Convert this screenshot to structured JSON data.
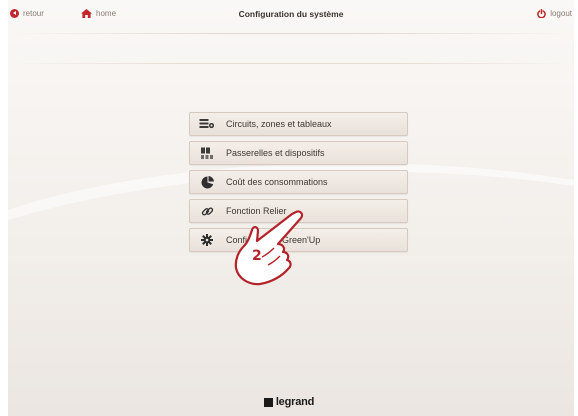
{
  "topbar": {
    "back_label": "retour",
    "home_label": "home",
    "title": "Configuration du système",
    "logout_label": "logout"
  },
  "menu": {
    "items": [
      {
        "label": "Circuits, zones et tableaux",
        "icon": "circuits-icon"
      },
      {
        "label": "Passerelles et dispositifs",
        "icon": "gateway-devices-icon"
      },
      {
        "label": "Coût des consommations",
        "icon": "pie-chart-icon"
      },
      {
        "label": "Fonction Relier",
        "icon": "link-icon"
      },
      {
        "label": "Configuration Green'Up",
        "icon": "gear-icon"
      }
    ]
  },
  "callout": {
    "number": "2",
    "icon": "pointing-hand-icon"
  },
  "footer": {
    "brand": "legrand",
    "brand_icon": "legrand-square-icon"
  },
  "colors": {
    "accent": "#c1272d",
    "nav_text": "#8a7b72",
    "title_text": "#3a3330"
  }
}
